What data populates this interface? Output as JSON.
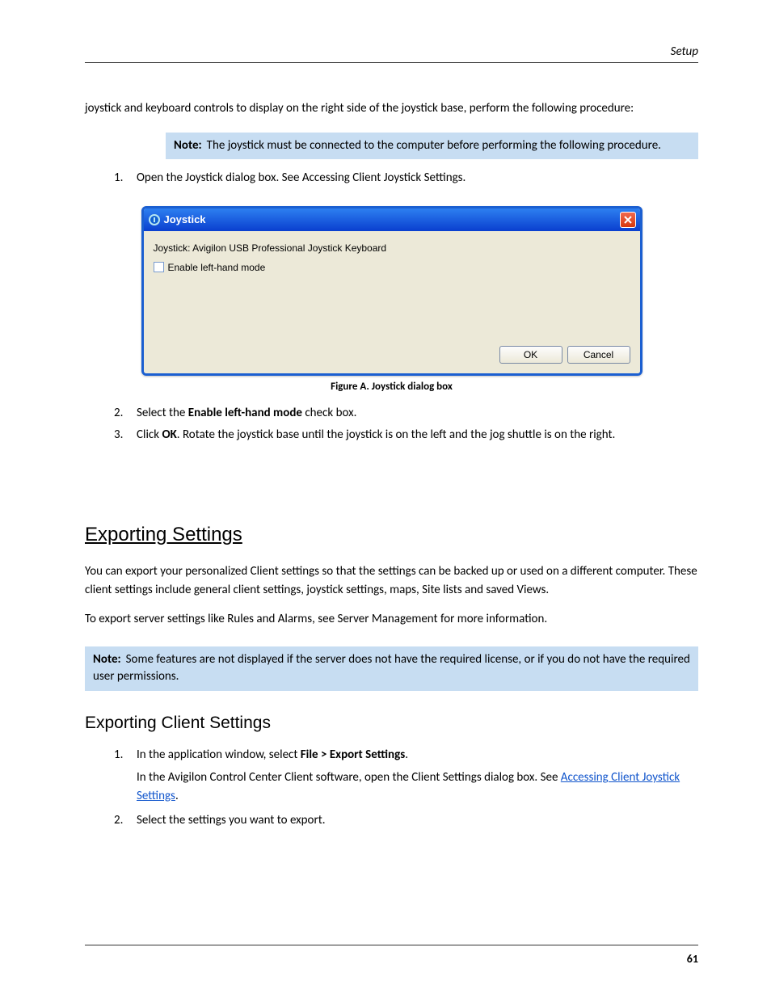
{
  "header": {
    "section": "Setup"
  },
  "intro": "joystick and keyboard controls to display on the right side of the joystick base, perform the following procedure:",
  "note1": {
    "label": "Note:",
    "text": "The joystick must be connected to the computer before performing the following procedure."
  },
  "steps_a": {
    "1": {
      "num": "1.",
      "text": "Open the Joystick dialog box. See ",
      "link_text": "Accessing Client Joystick Settings"
    },
    "period": "."
  },
  "dialog": {
    "title": "Joystick",
    "label": "Joystick: Avigilon USB Professional Joystick Keyboard",
    "checkbox": "Enable left-hand mode",
    "ok": "OK",
    "cancel": "Cancel"
  },
  "figure_caption": "Figure A. Joystick dialog box",
  "steps_b": {
    "2": {
      "num": "2.",
      "text_before": "Select the ",
      "bold": "Enable left-hand mode",
      "text_after": " check box."
    },
    "3": {
      "num": "3.",
      "text_before": "Click ",
      "bold": "OK",
      "text_after": ". Rotate the joystick base until the joystick is on the left and the jog shuttle is on the right."
    }
  },
  "heading2": "Exporting Settings",
  "para2": "You can export your personalized Client settings so that the settings can be backed up or used on a different computer. These client settings include general client settings, joystick settings, maps, Site lists and saved Views.",
  "para2b": "To export server settings like Rules and Alarms, see Server Management for more information.",
  "note2": {
    "label": "Note:",
    "text": "Some features are not displayed if the server does not have the required license, or if you do not have the required user permissions."
  },
  "heading3": "Exporting Client Settings",
  "steps_c": {
    "1": {
      "num": "1.",
      "text_before": "In the application window, select ",
      "bold1": "File > Export Settings",
      "text_after": "."
    },
    "filemenu_hint": "",
    "2": {
      "num": "2.",
      "text": "Select the settings you want to export."
    }
  },
  "hint_text": "In the Avigilon Control Center Client software, open the Client Settings dialog box. See ",
  "hint_link": "Accessing Client Joystick Settings",
  "footer": {
    "page": "61"
  }
}
